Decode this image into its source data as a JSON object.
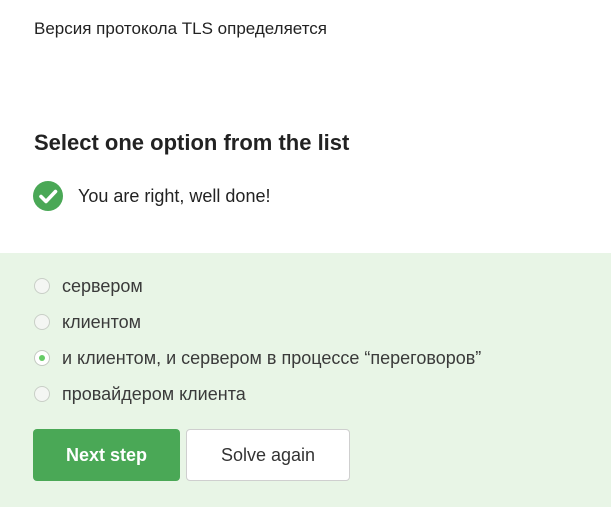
{
  "question": {
    "text": "Версия протокола TLS определяется"
  },
  "task": {
    "heading": "Select one option from the list"
  },
  "feedback": {
    "icon": "check-circle-icon",
    "text": "You are right, well done!",
    "color": "#4aa856"
  },
  "options": [
    {
      "label": "сервером",
      "selected": false
    },
    {
      "label": "клиентом",
      "selected": false
    },
    {
      "label": "и клиентом, и сервером в процессе “переговоров”",
      "selected": true
    },
    {
      "label": "провайдером клиента",
      "selected": false
    }
  ],
  "actions": {
    "next_label": "Next step",
    "solve_again_label": "Solve again"
  },
  "colors": {
    "panel_background": "#e8f5e6",
    "primary_button": "#4aa856",
    "radio_selected": "#66cc66"
  }
}
